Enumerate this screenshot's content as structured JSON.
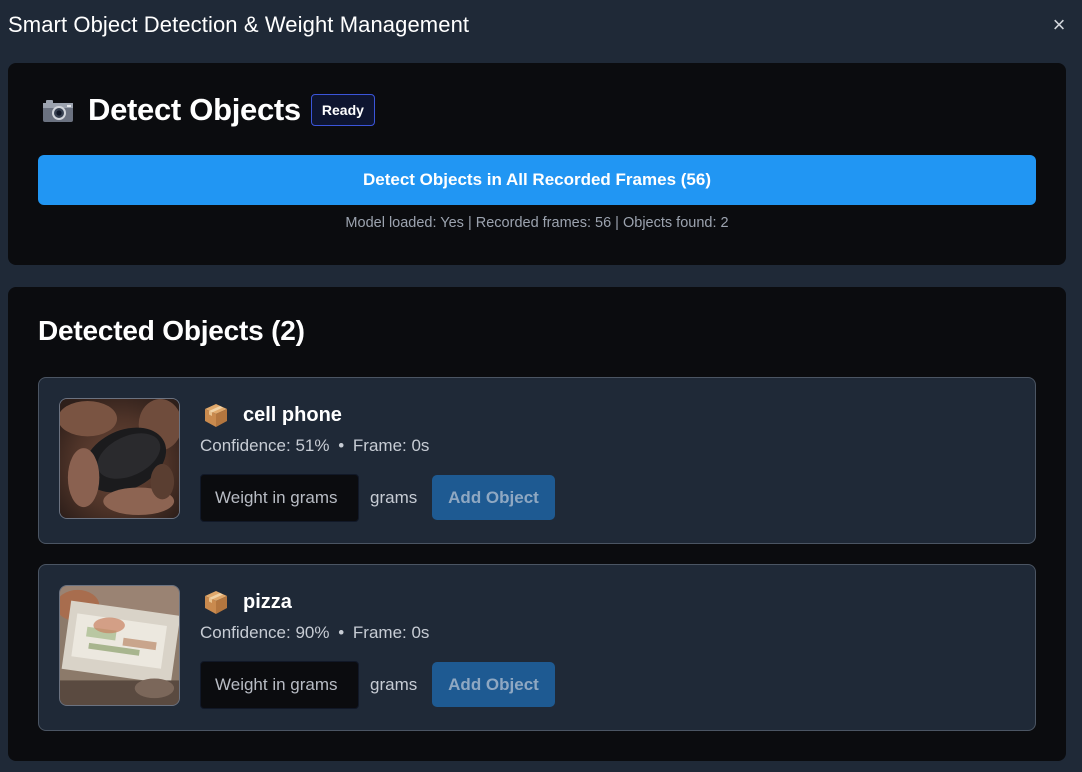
{
  "modal": {
    "title": "Smart Object Detection & Weight Management",
    "close_label": "×"
  },
  "detect": {
    "icon": "camera-icon",
    "title": "Detect Objects",
    "status_badge": "Ready",
    "button_label": "Detect Objects in All Recorded Frames (56)",
    "status_line": "Model loaded: Yes | Recorded frames: 56 | Objects found: 2"
  },
  "objects": {
    "title": "Detected Objects (2)",
    "items": [
      {
        "icon": "package-icon",
        "name": "cell phone",
        "confidence": "Confidence: 51%",
        "separator": "•",
        "frame": "Frame: 0s",
        "weight_placeholder": "Weight in grams",
        "unit": "grams",
        "add_label": "Add Object"
      },
      {
        "icon": "package-icon",
        "name": "pizza",
        "confidence": "Confidence: 90%",
        "separator": "•",
        "frame": "Frame: 0s",
        "weight_placeholder": "Weight in grams",
        "unit": "grams",
        "add_label": "Add Object"
      }
    ]
  },
  "colors": {
    "background": "#1f2937",
    "card": "#0b0c0f",
    "primary_button": "#2196f3",
    "disabled_button": "#1e5a92",
    "badge_border": "#3b55d9"
  }
}
